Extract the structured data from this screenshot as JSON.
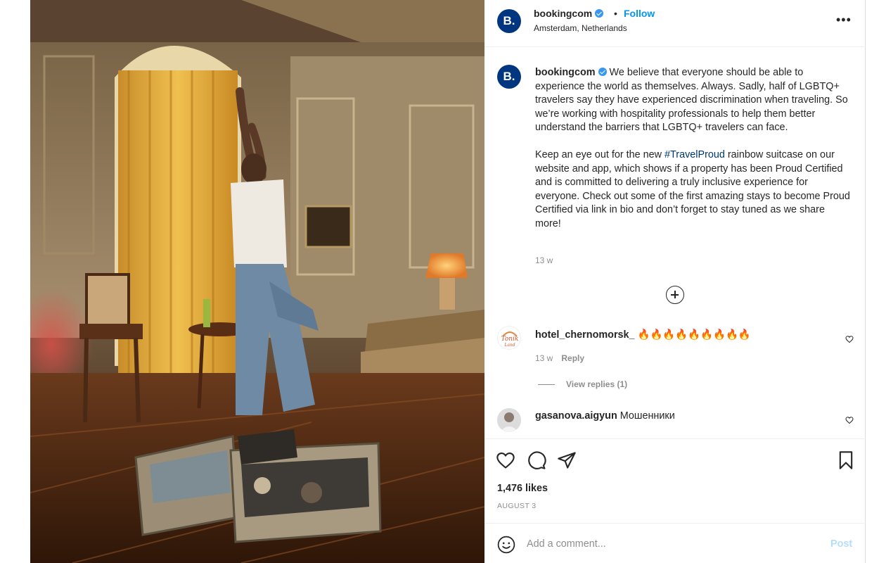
{
  "post": {
    "username": "bookingcom",
    "avatar_letter": "B.",
    "follow_label": "Follow",
    "separator": "•",
    "location": "Amsterdam, Netherlands",
    "more_icon": "more-horizontal-icon",
    "caption_p1": "We believe that everyone should be able to experience the world as themselves. Always. Sadly, half of LGBTQ+ travelers say they have experienced discrimination when traveling. So we’re working with hospitality professionals to help them better understand the barriers that LGBTQ+ travelers can face.",
    "caption_p2_before": "Keep an eye out for the new ",
    "hashtag": "#TravelProud",
    "caption_p2_after": " rainbow suitcase on our website and app, which shows if a property has been Proud Certified and is committed to delivering a truly inclusive experience for everyone. Check out some of the first amazing stays to become Proud Certified via link in bio and don’t forget to stay tuned as we share more!",
    "caption_time": "13 w",
    "likes": "1,476 likes",
    "date": "AUGUST 3"
  },
  "comments": [
    {
      "username": "hotel_chernomorsk_",
      "text": "🔥🔥🔥🔥🔥🔥🔥🔥🔥",
      "time": "13 w",
      "reply_label": "Reply",
      "view_replies": "View replies (1)",
      "avatar_text": "Tonik Land"
    },
    {
      "username": "gasanova.aigyun",
      "text": "Мошенники"
    }
  ],
  "add_comment": {
    "placeholder": "Add a comment...",
    "post_label": "Post"
  },
  "colors": {
    "brand": "#003580",
    "link": "#0095f6",
    "hashtag": "#00376b",
    "muted": "#8e8e8e",
    "post_disabled": "#b2dffc"
  }
}
